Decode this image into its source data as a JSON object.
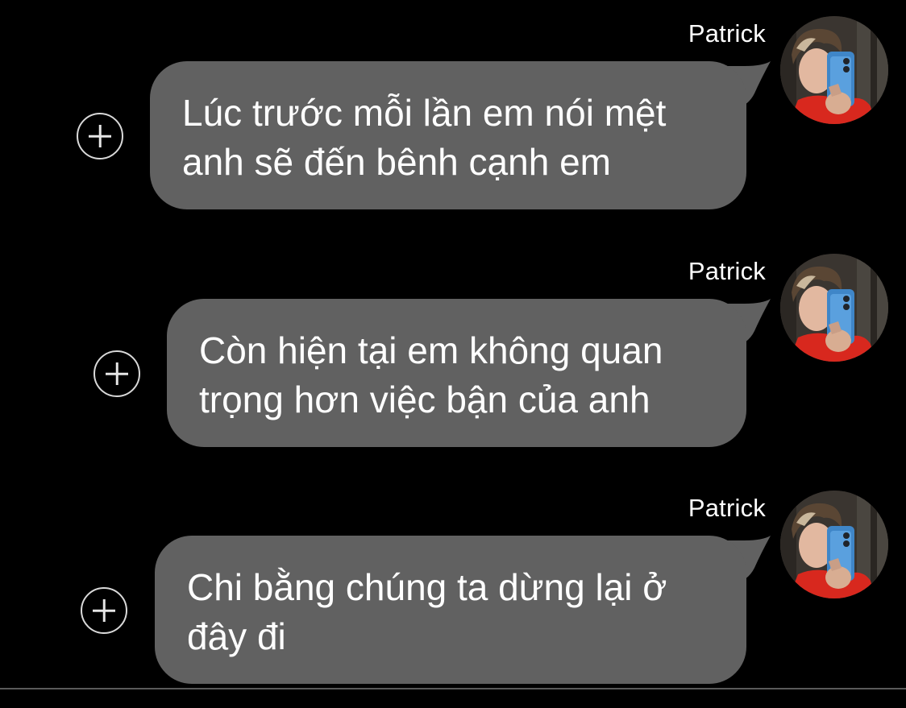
{
  "thread": {
    "messages": [
      {
        "sender": "Patrick",
        "line1": "Lúc trước mỗi lần em nói mệt",
        "line2": "anh sẽ đến bênh cạnh em"
      },
      {
        "sender": "Patrick",
        "line1": "Còn hiện tại em không quan",
        "line2": "trọng hơn việc bận của anh"
      },
      {
        "sender": "Patrick",
        "line1": "Chi bằng chúng ta dừng lại ở",
        "line2": "đây đi"
      }
    ]
  },
  "colors": {
    "background": "#000000",
    "bubble": "#616161",
    "text": "#ffffff",
    "add_icon": "#d9d9d9"
  },
  "icons": {
    "add": "plus-circle-icon",
    "avatar": "avatar-photo"
  }
}
